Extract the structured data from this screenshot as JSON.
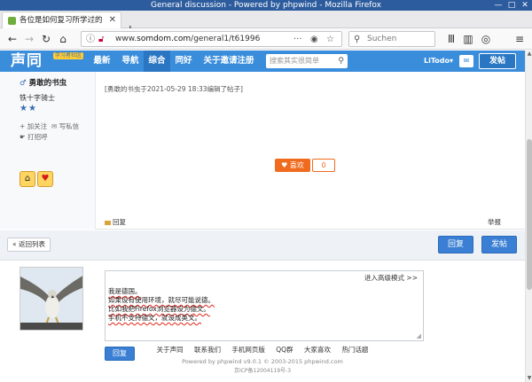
{
  "window": {
    "title": "General discussion - Powered by phpwind - Mozilla Firefox",
    "minimize_glyph": "—",
    "maximize_glyph": "□",
    "close_glyph": "✕"
  },
  "tab": {
    "title": "各位是如何复习所学过的",
    "close_glyph": "✕"
  },
  "new_tab_glyph": "+",
  "nav": {
    "back_glyph": "←",
    "forward_glyph": "→",
    "reload_glyph": "↻",
    "home_glyph": "⌂",
    "url_prefix": "www.",
    "url_domain": "somdom.com",
    "url_path": "/general1/t61996",
    "page_actions_glyph": "···",
    "pocket_glyph": "◉",
    "bookmark_glyph": "☆",
    "search_placeholder": "Suchen",
    "library_glyph": "Ⅲ",
    "sidebar_glyph": "▥",
    "account_glyph": "◎",
    "menu_glyph": "≡"
  },
  "site": {
    "logo": "声同",
    "logo_tag": "学习者社区",
    "nav": [
      "最新",
      "导航",
      "综合",
      "同好",
      "关于邀请注册"
    ],
    "active_nav": "综合",
    "search_placeholder": "搜索其实很简单",
    "search_glyph": "⚲",
    "username": "LiTodo",
    "user_caret": "▾",
    "mail_glyph": "✉",
    "post_button": "发帖"
  },
  "post": {
    "author": "勇敢的书虫",
    "rank": "铁十字骑士",
    "stars": "★★",
    "follow": "加关注",
    "message": "写私信",
    "greet": "打招呼",
    "edit_note": "[勇敢的书虫于2021-05-29 18:33编辑了帖子]",
    "like_label": "喜欢",
    "like_count": "0",
    "reply_link": "回复",
    "report_link": "举报"
  },
  "actions": {
    "back_to_list": "« 返回列表",
    "reply": "回复",
    "post": "发帖"
  },
  "quick_reply": {
    "advanced_mode": "进入高级模式 >>",
    "lines": [
      "我是德国。",
      "如果设有使用环境，就尽可能说德。",
      "比如我把Firefox浏览器设为德文。",
      "手机不支持德文，就设成英文。"
    ],
    "submit": "回复"
  },
  "footer": {
    "links": [
      "关于声同",
      "联系我们",
      "手机网页版",
      "QQ群",
      "大家喜欢",
      "热门话题"
    ],
    "copyright": "Powered by phpwind v9.0.1 © 2003-2015 phpwind.com",
    "icp": "京ICP备12004119号-3"
  }
}
